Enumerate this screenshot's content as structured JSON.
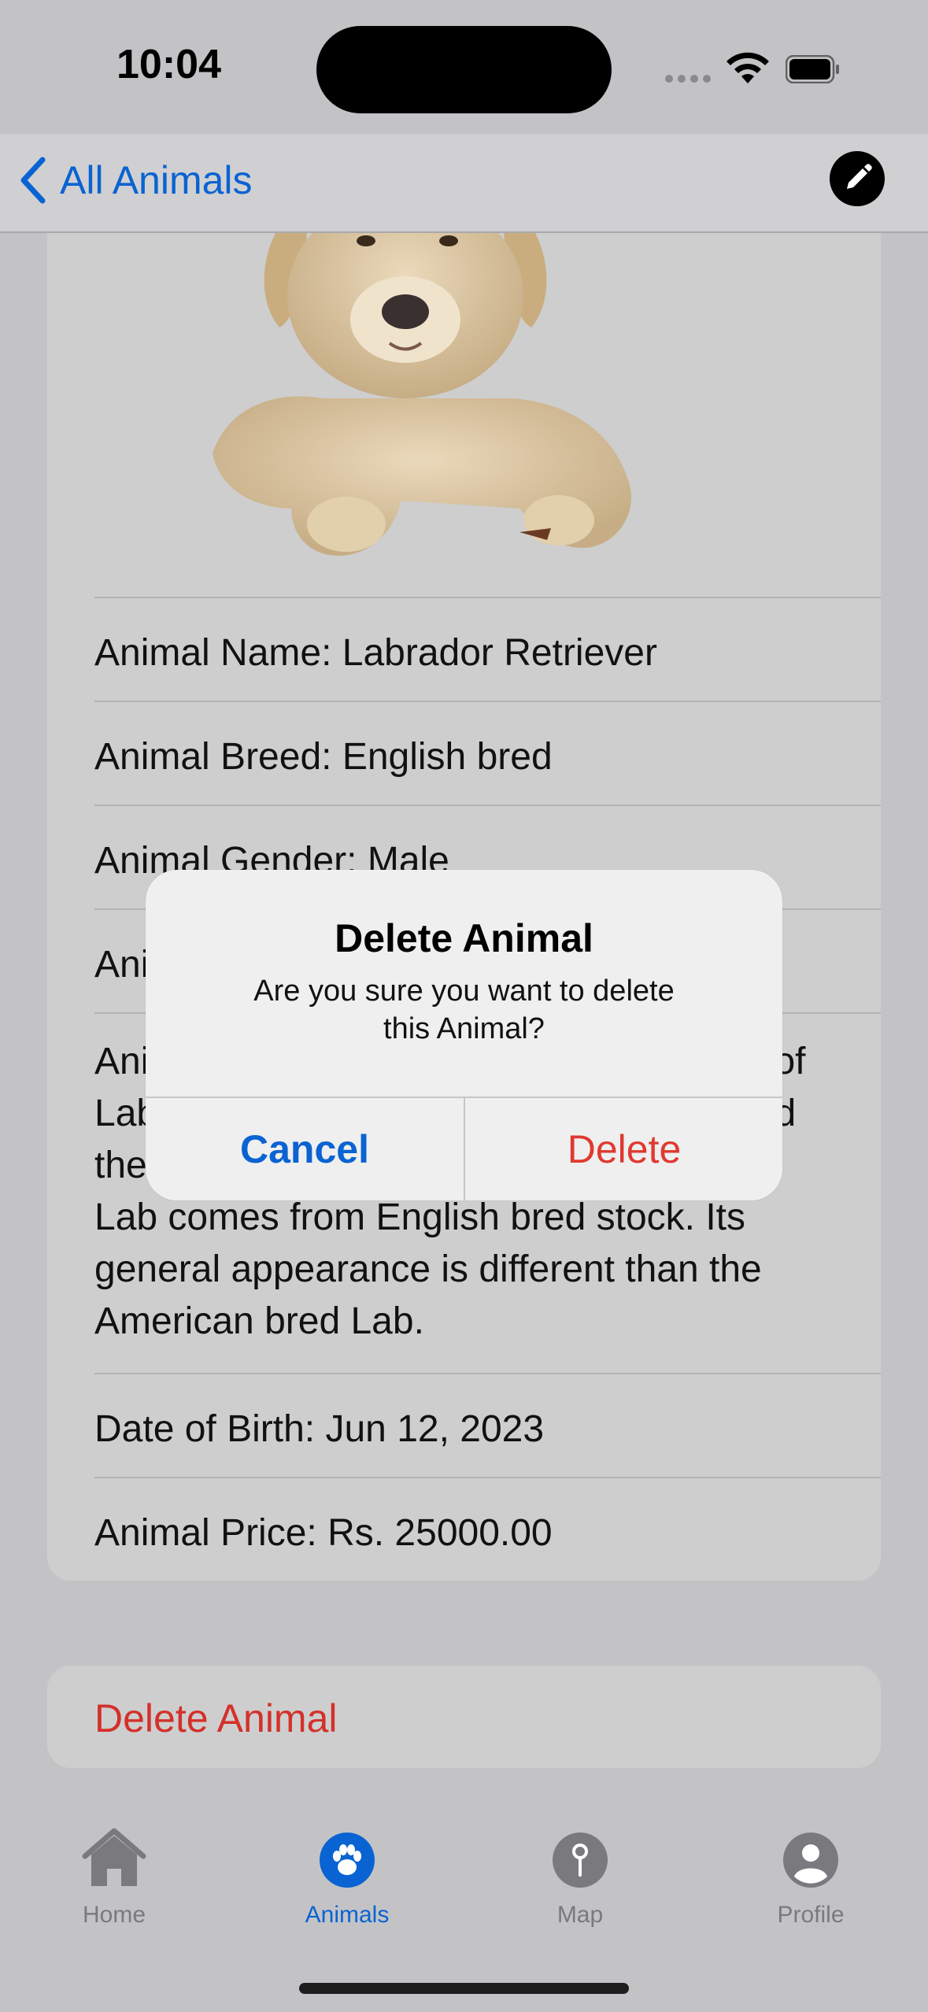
{
  "status_bar": {
    "time": "10:04"
  },
  "nav": {
    "back_label": "All Animals",
    "edit_icon": "pencil-icon"
  },
  "details": {
    "name": "Animal Name: Labrador Retriever",
    "breed": "Animal Breed:  English bred",
    "gender": "Animal Gender: Male",
    "age_partial": "Ani",
    "description": "Animal Description: There are two types of Labrador Retrievers, the English bred and the American bred Lab. The English bred Lab comes from English bred stock. Its general appearance is different than the American bred Lab.",
    "dob": "Date of Birth: Jun 12, 2023",
    "price": "Animal Price: Rs. 25000.00"
  },
  "delete_button": {
    "label": "Delete Animal"
  },
  "tabs": [
    {
      "label": "Home",
      "icon": "house-icon",
      "active": false
    },
    {
      "label": "Animals",
      "icon": "paw-icon",
      "active": true
    },
    {
      "label": "Map",
      "icon": "map-pin-icon",
      "active": false
    },
    {
      "label": "Profile",
      "icon": "person-icon",
      "active": false
    }
  ],
  "alert": {
    "title": "Delete Animal",
    "message": "Are you sure you want to delete this Animal?",
    "cancel": "Cancel",
    "confirm": "Delete"
  },
  "colors": {
    "accent": "#0a63d2",
    "destructive": "#e0392f",
    "overlay": "#c3c3c6"
  }
}
